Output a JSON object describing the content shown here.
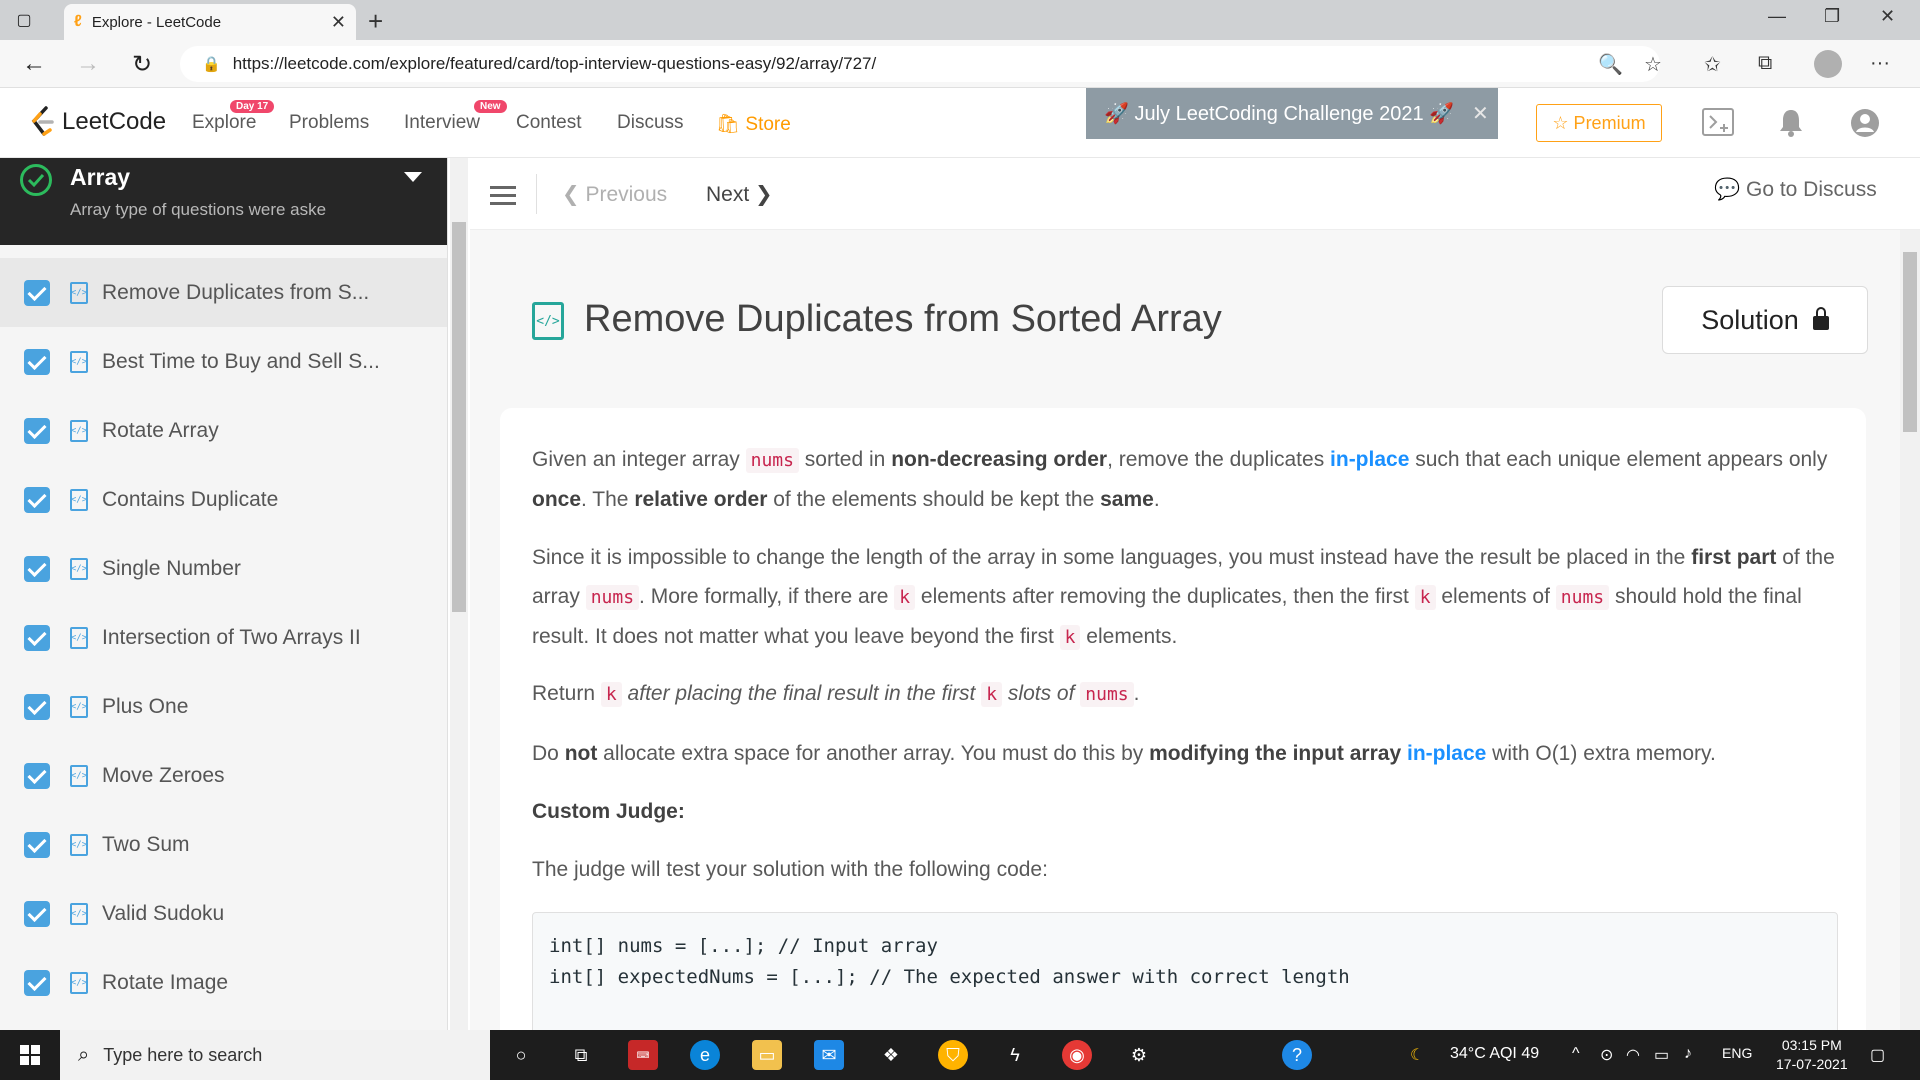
{
  "browser": {
    "tab_title": "Explore - LeetCode",
    "url": "https://leetcode.com/explore/featured/card/top-interview-questions-easy/92/array/727/"
  },
  "navbar": {
    "logo": "LeetCode",
    "items": [
      {
        "label": "Explore",
        "badge": "Day 17"
      },
      {
        "label": "Problems"
      },
      {
        "label": "Interview",
        "badge": "New"
      },
      {
        "label": "Contest"
      },
      {
        "label": "Discuss"
      },
      {
        "label": "Store"
      }
    ],
    "challenge": "🚀 July LeetCoding Challenge 2021 🚀",
    "premium": "☆ Premium"
  },
  "sidebar": {
    "title": "Array",
    "subtitle": "Array type of questions were aske",
    "items": [
      {
        "label": "Remove Duplicates from S..."
      },
      {
        "label": "Best Time to Buy and Sell S..."
      },
      {
        "label": "Rotate Array"
      },
      {
        "label": "Contains Duplicate"
      },
      {
        "label": "Single Number"
      },
      {
        "label": "Intersection of Two Arrays II"
      },
      {
        "label": "Plus One"
      },
      {
        "label": "Move Zeroes"
      },
      {
        "label": "Two Sum"
      },
      {
        "label": "Valid Sudoku"
      },
      {
        "label": "Rotate Image"
      }
    ]
  },
  "topbar": {
    "previous": "Previous",
    "next": "Next",
    "discuss": "Go to Discuss"
  },
  "problem": {
    "title": "Remove Duplicates from Sorted Array",
    "solution_label": "Solution",
    "p1": {
      "t1": "Given an integer array ",
      "c1": "nums",
      "t2": " sorted in ",
      "b1": "non-decreasing order",
      "t3": ", remove the duplicates ",
      "l1": "in-place",
      "t4": " such that each unique element appears only ",
      "b2": "once",
      "t5": ". The ",
      "b3": "relative order",
      "t6": " of the elements should be kept the ",
      "b4": "same",
      "t7": "."
    },
    "p2": {
      "t1": "Since it is impossible to change the length of the array in some languages, you must instead have the result be placed in the ",
      "b1": "first part",
      "t2": " of the array ",
      "c1": "nums",
      "t3": ". More formally, if there are ",
      "c2": "k",
      "t4": " elements after removing the duplicates, then the first ",
      "c3": "k",
      "t5": " elements of ",
      "c4": "nums",
      "t6": " should hold the final result. It does not matter what you leave beyond the first ",
      "c5": "k",
      "t7": " elements."
    },
    "p3": {
      "t1": "Return ",
      "c1": "k",
      "i1": " after placing the final result in the first ",
      "c2": "k",
      "i2": " slots of ",
      "c3": "nums",
      "t2": "."
    },
    "p4": {
      "t1": "Do ",
      "b1": "not",
      "t2": " allocate extra space for another array. You must do this by ",
      "b2": "modifying the input array",
      "t3": " ",
      "l1": "in-place",
      "t4": " with O(1) extra memory."
    },
    "custom_judge": "Custom Judge:",
    "judge_text": "The judge will test your solution with the following code:",
    "code_lines": [
      "int[] nums = [...]; // Input array",
      "int[] expectedNums = [...]; // The expected answer with correct length"
    ]
  },
  "taskbar": {
    "search_placeholder": "Type here to search",
    "weather": "34°C  AQI 49",
    "lang": "ENG",
    "time": "03:15 PM",
    "date": "17-07-2021"
  }
}
